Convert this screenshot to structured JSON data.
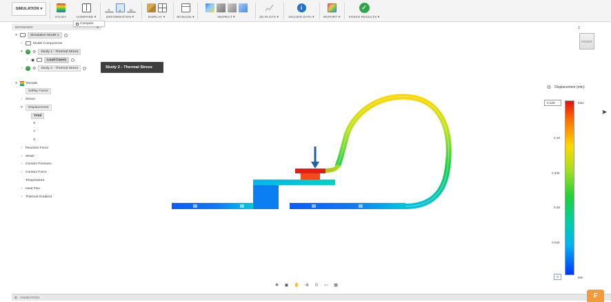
{
  "toolbar": {
    "workspace": "SIMULATION",
    "groups": {
      "study": "STUDY",
      "compare": "COMPARE",
      "deformation": "DEFORMATION",
      "display": "DISPLAY",
      "manage": "MANAGE",
      "inspect": "INSPECT",
      "plots": "2D PLOTS",
      "solver": "SOLVER DATA",
      "report": "REPORT",
      "finish": "FINISH RESULTS"
    },
    "deformation_icon_labels": [
      "0",
      "2",
      "1x"
    ],
    "compare_popup": "Compare"
  },
  "browser": {
    "header": "BROWSER",
    "items": {
      "model": "Simulation Model 1",
      "components": "Model Components",
      "study1": "Study 1 - Thermal Stress",
      "loadcase": "Load Case1",
      "study2": "Study 2 - Thermal Stress"
    },
    "tooltip": "Study 2 - Thermal Stress",
    "results": {
      "root": "Results",
      "safety": "Safety Factor",
      "stress": "Stress",
      "displacement": "Displacement",
      "total": "Total",
      "x": "X",
      "y": "Y",
      "z": "Z",
      "reaction": "Reaction Force",
      "strain": "Strain",
      "pressure": "Contact Pressure",
      "contactforce": "Contact Force",
      "temperature": "Temperature",
      "heatflux": "Heat Flux",
      "gradient": "Thermal Gradient"
    }
  },
  "viewcube": {
    "face": "FRONT",
    "axis": "Z"
  },
  "legend": {
    "title": "Displacement (mm)",
    "max_value": "0.225",
    "min_value": "0",
    "max_label": "Max",
    "min_label": "Min",
    "ticks": [
      "0.18",
      "0.135",
      "0.09",
      "0.045"
    ]
  },
  "bottom": {
    "animation": "ANIMATION",
    "badge": "F"
  },
  "colors": {
    "accent": "#1f76c2",
    "legend_max": "#e01010",
    "legend_min": "#0036ff",
    "check": "#2e9b3b"
  }
}
